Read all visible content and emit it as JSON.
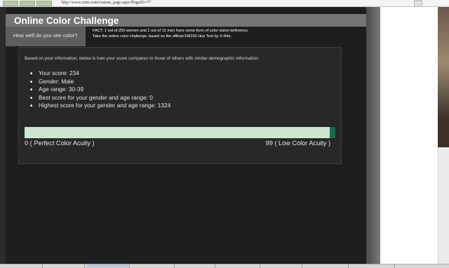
{
  "browser": {
    "url": "http://www.xrite.com/custom_page.aspx?PageID=77"
  },
  "header": {
    "title": "Online Color Challenge",
    "subtitle_tab": "How well do you see color?",
    "fact_line1": "FACT: 1 out of 255 women and 1 out of 12 men have some form of color vision deficiency.",
    "fact_line2": "Take the online color challenge, based on the official FM100 Hue Test by X-Rite."
  },
  "results": {
    "intro": "Based on your information, below is how your score compares to those of others with similar demographic information.",
    "items": [
      "Your score: 234",
      "Gender: Male",
      "Age range: 30-39",
      "Best score for your gender and age range: 0",
      "Highest score for your gender and age range: 1324"
    ],
    "score_percentile": 99,
    "scale_left_label": "0 ( Perfect Color Acuity )",
    "scale_right_label": "99 ( Low Color Acuity )"
  },
  "colors": {
    "page_bg": "#1e1e1e",
    "header_bg": "#747474",
    "bar_bg": "#c9e4cc",
    "bar_marker": "#146b4a"
  }
}
